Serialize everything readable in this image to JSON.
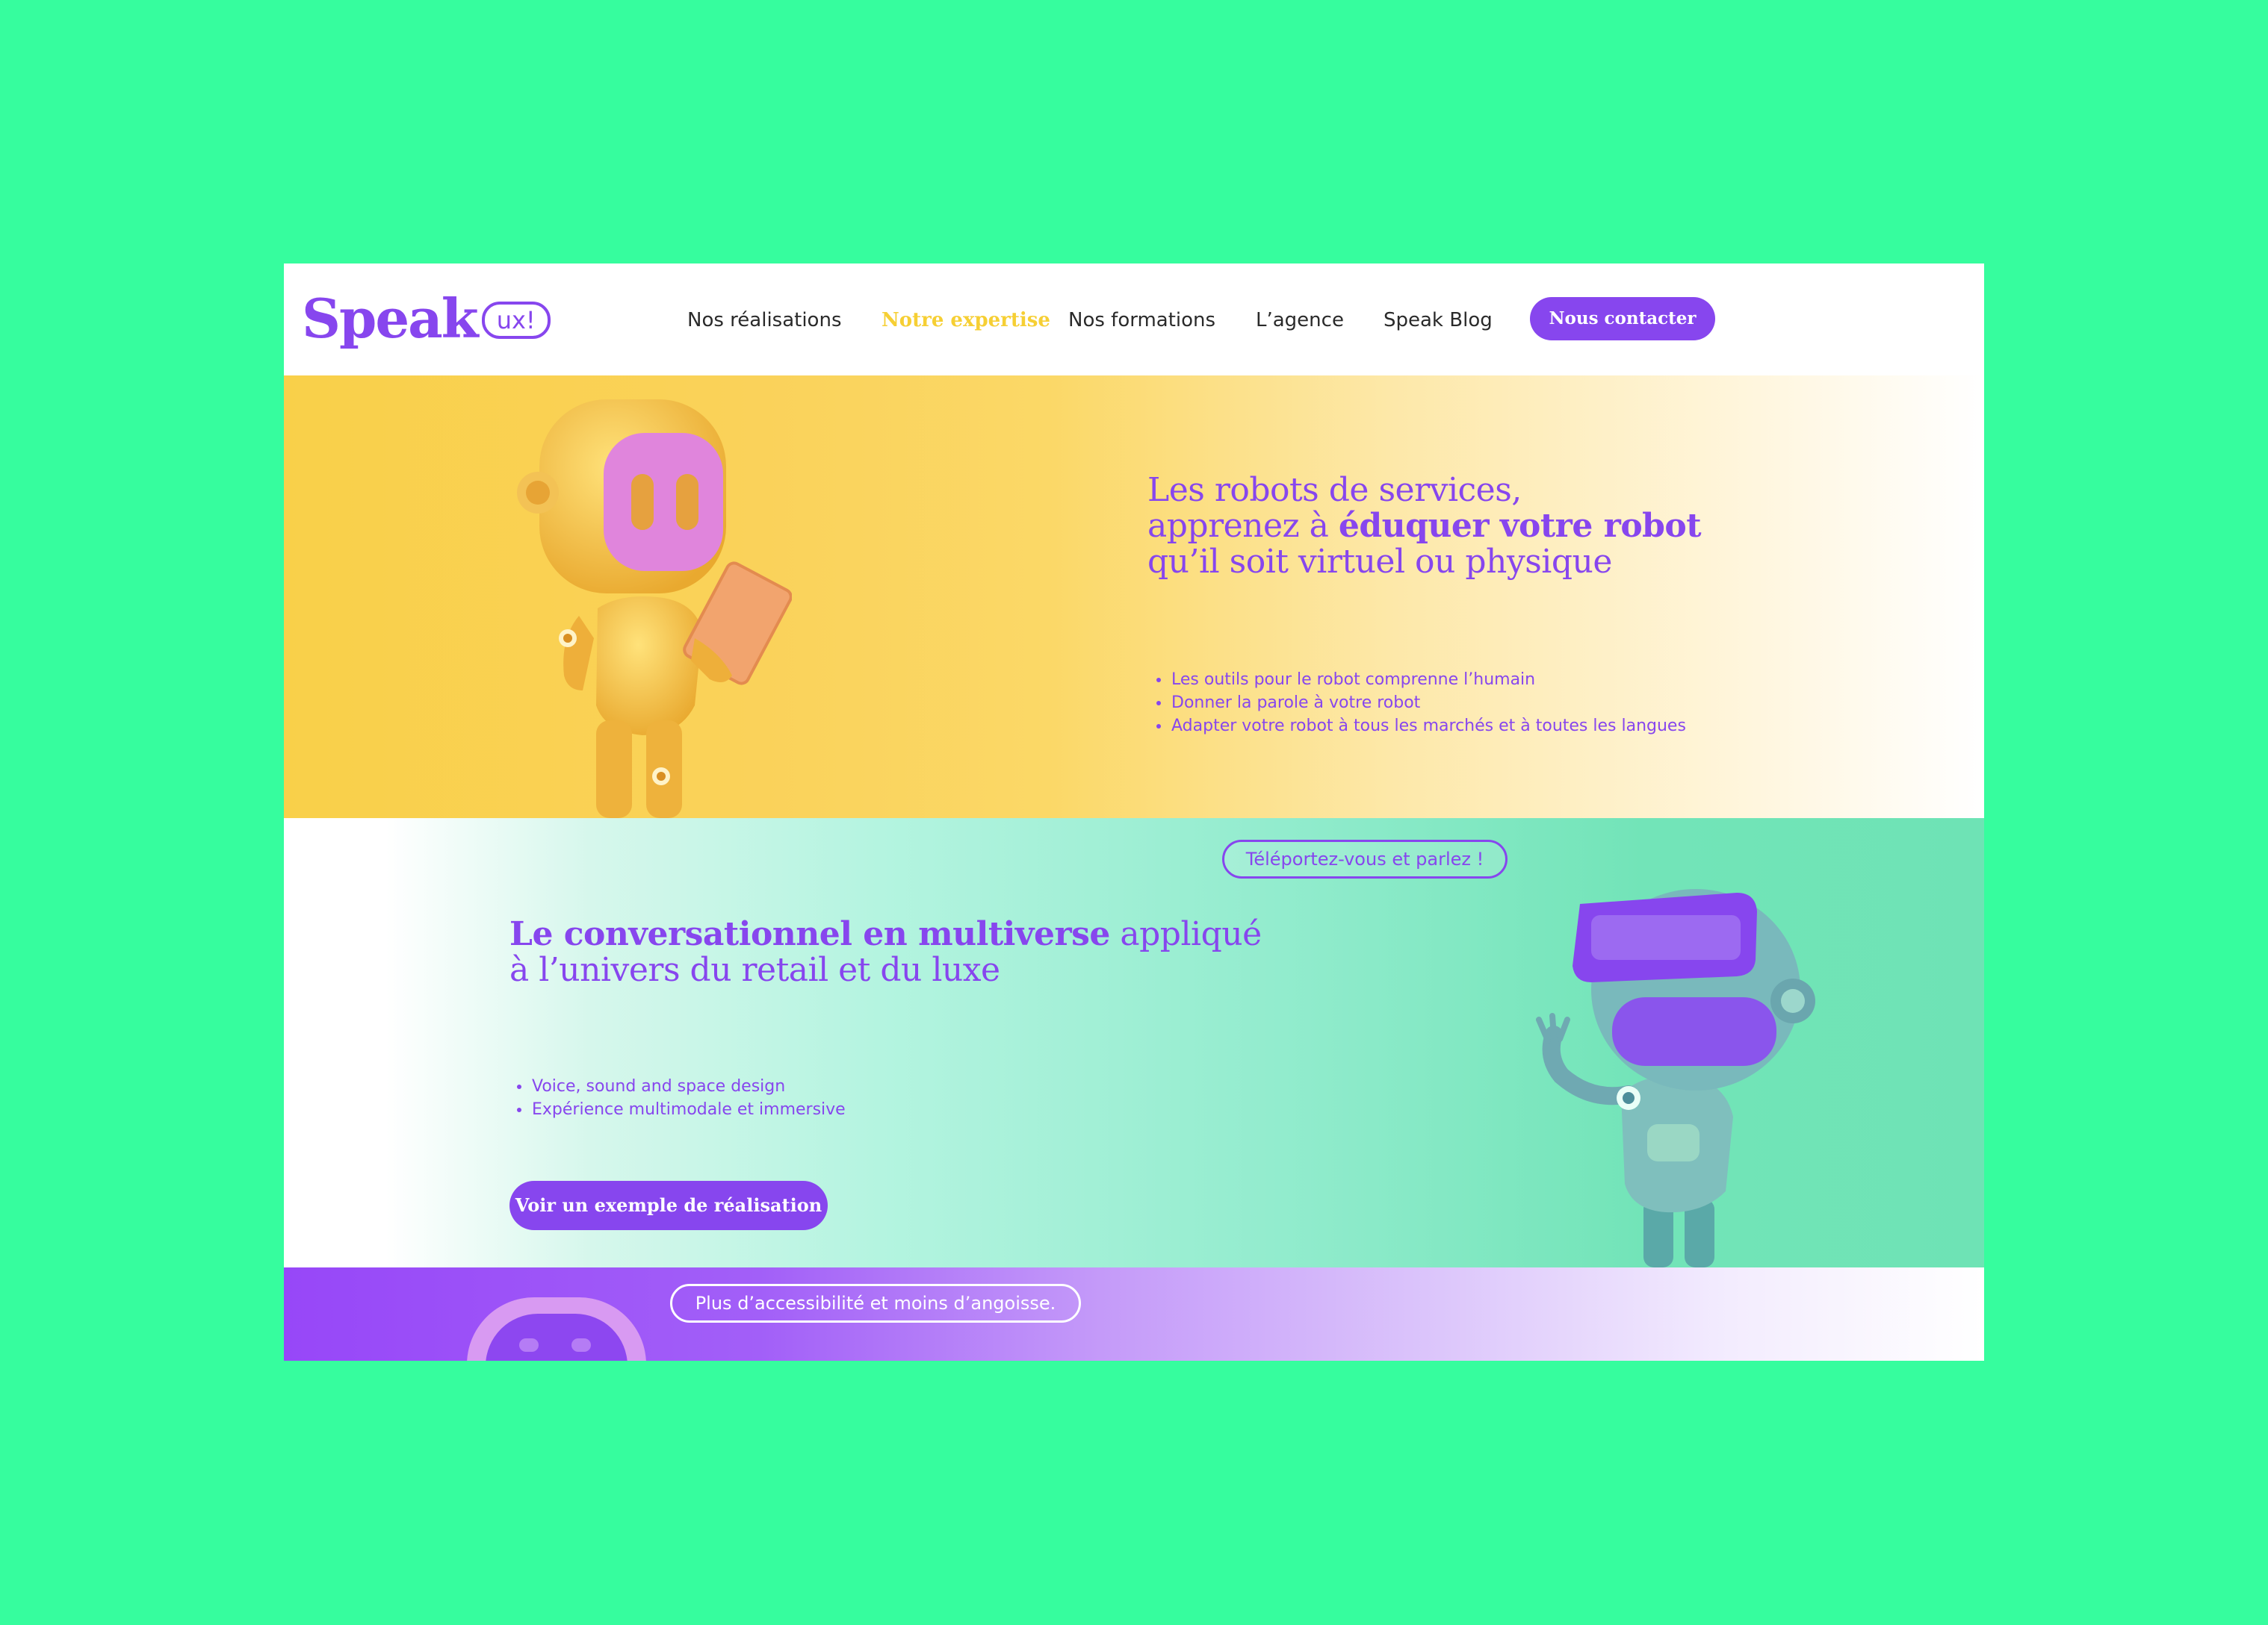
{
  "colors": {
    "page_background": "#36fd9e",
    "brand_purple": "#8746ee",
    "accent_yellow": "#f6cf34",
    "mint": "#6ee3b5"
  },
  "header": {
    "logo_word": "Speak",
    "logo_bubble": "ux!",
    "nav": [
      {
        "label": "Nos réalisations",
        "active": false
      },
      {
        "label": "Notre expertise",
        "active": true
      },
      {
        "label": "Nos formations",
        "active": false
      },
      {
        "label": "L’agence",
        "active": false
      },
      {
        "label": "Speak Blog",
        "active": false
      }
    ],
    "contact_button": "Nous contacter"
  },
  "section_robots": {
    "title_line1": "Les robots de services,",
    "title_line2_prefix": "apprenez à ",
    "title_line2_bold": "éduquer votre robot",
    "title_line3": "qu’il soit virtuel ou physique",
    "bullets": [
      "Les outils pour le robot comprenne l’humain",
      "Donner la parole à votre robot",
      "Adapter votre robot à tous les marchés et à toutes les langues"
    ],
    "image": "yellow-robot-with-tablet"
  },
  "section_multiverse": {
    "title_bold": "Le conversationnel en multiverse",
    "title_rest": " appliqué",
    "title_line2": "à l’univers du retail et du luxe",
    "bullets": [
      "Voice, sound and space design",
      "Expérience multimodale et immersive"
    ],
    "cta": "Voir un exemple de réalisation",
    "speech_bubble": "Téléportez-vous et parlez !",
    "image": "vr-headset-robot"
  },
  "section_accessibility": {
    "speech_bubble": "Plus d’accessibilité et moins d’angoisse.",
    "image": "purple-robot-head"
  }
}
